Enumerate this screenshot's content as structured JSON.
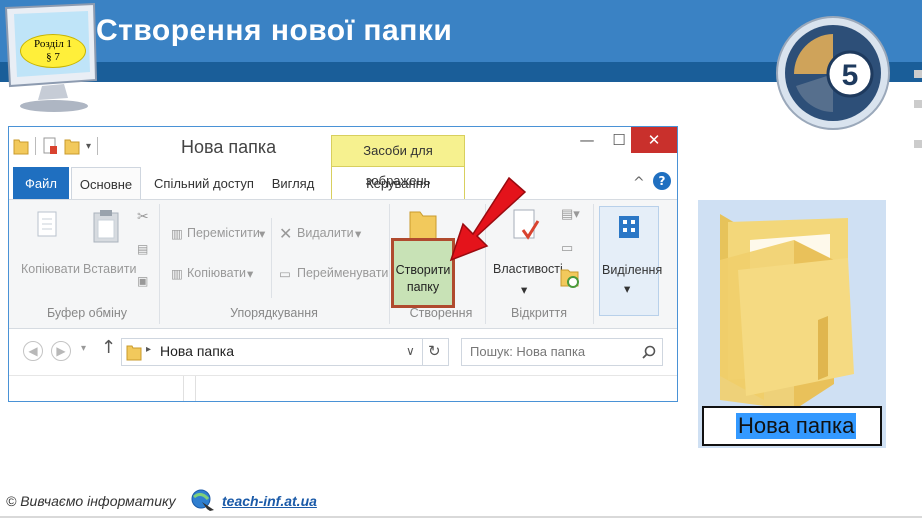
{
  "slide": {
    "title": "Створення нової папки",
    "section_line1": "Розділ 1",
    "section_line2": "§ 7",
    "grade_number": "5"
  },
  "window": {
    "title": "Нова папка",
    "context_group": "Засоби для зображень",
    "close_glyph": "✕",
    "minimize_glyph": "—",
    "maximize_glyph": "☐"
  },
  "tabs": {
    "file": "Файл",
    "home": "Основне",
    "share": "Спільний доступ",
    "view": "Вигляд",
    "manage": "Керування",
    "collapse_glyph": "^",
    "help_glyph": "?"
  },
  "ribbon": {
    "clipboard": {
      "copy": "Копіювати",
      "paste": "Вставити",
      "label": "Буфер обміну"
    },
    "organize": {
      "move": "Перемістити",
      "copy_to": "Копіювати",
      "delete": "Видалити",
      "rename": "Перейменувати",
      "label": "Упорядкування"
    },
    "new": {
      "create_line1": "Створити",
      "create_line2": "папку",
      "label": "Створення"
    },
    "open": {
      "properties": "Властивості",
      "label": "Відкриття"
    },
    "select": {
      "select": "Виділення"
    }
  },
  "address": {
    "path": "Нова папка",
    "search_placeholder": "Пошук: Нова папка"
  },
  "folder_preview": {
    "name": "Нова папка"
  },
  "footer": {
    "copyright": "© Вивчаємо інформатику",
    "site": "teach-inf.at.ua"
  },
  "colors": {
    "banner": "#3a82c4",
    "banner_dark": "#1a5e99",
    "file_tab": "#1f6fc0",
    "context_tab": "#f6f18f",
    "create_highlight": "#c8e2b6",
    "highlight_border": "#b04a2e",
    "arrow": "#e4131b",
    "selection": "#3399ff"
  },
  "icons": [
    "monitor-icon",
    "folder-icon",
    "arrow-icon",
    "search-icon",
    "refresh-icon",
    "back-icon",
    "forward-icon",
    "up-icon",
    "help-icon",
    "scissors-icon",
    "paste-icon",
    "copy-icon",
    "move-icon",
    "delete-icon",
    "rename-icon",
    "properties-icon",
    "select-icon",
    "globe-icon"
  ]
}
